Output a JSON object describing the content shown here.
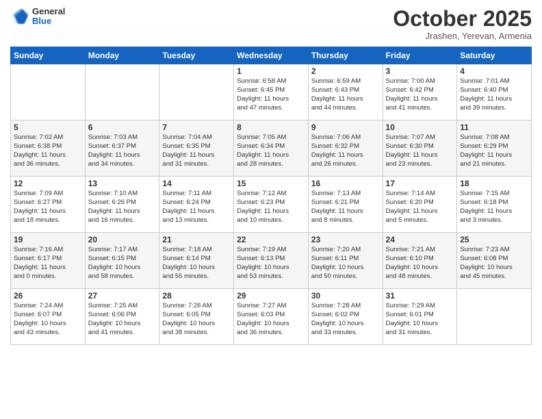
{
  "header": {
    "logo_general": "General",
    "logo_blue": "Blue",
    "month_title": "October 2025",
    "subtitle": "Jrashen, Yerevan, Armenia"
  },
  "days_of_week": [
    "Sunday",
    "Monday",
    "Tuesday",
    "Wednesday",
    "Thursday",
    "Friday",
    "Saturday"
  ],
  "weeks": [
    [
      {
        "day": "",
        "info": ""
      },
      {
        "day": "",
        "info": ""
      },
      {
        "day": "",
        "info": ""
      },
      {
        "day": "1",
        "info": "Sunrise: 6:58 AM\nSunset: 6:45 PM\nDaylight: 11 hours\nand 47 minutes."
      },
      {
        "day": "2",
        "info": "Sunrise: 6:59 AM\nSunset: 6:43 PM\nDaylight: 11 hours\nand 44 minutes."
      },
      {
        "day": "3",
        "info": "Sunrise: 7:00 AM\nSunset: 6:42 PM\nDaylight: 11 hours\nand 41 minutes."
      },
      {
        "day": "4",
        "info": "Sunrise: 7:01 AM\nSunset: 6:40 PM\nDaylight: 11 hours\nand 39 minutes."
      }
    ],
    [
      {
        "day": "5",
        "info": "Sunrise: 7:02 AM\nSunset: 6:38 PM\nDaylight: 11 hours\nand 36 minutes."
      },
      {
        "day": "6",
        "info": "Sunrise: 7:03 AM\nSunset: 6:37 PM\nDaylight: 11 hours\nand 34 minutes."
      },
      {
        "day": "7",
        "info": "Sunrise: 7:04 AM\nSunset: 6:35 PM\nDaylight: 11 hours\nand 31 minutes."
      },
      {
        "day": "8",
        "info": "Sunrise: 7:05 AM\nSunset: 6:34 PM\nDaylight: 11 hours\nand 28 minutes."
      },
      {
        "day": "9",
        "info": "Sunrise: 7:06 AM\nSunset: 6:32 PM\nDaylight: 11 hours\nand 26 minutes."
      },
      {
        "day": "10",
        "info": "Sunrise: 7:07 AM\nSunset: 6:30 PM\nDaylight: 11 hours\nand 23 minutes."
      },
      {
        "day": "11",
        "info": "Sunrise: 7:08 AM\nSunset: 6:29 PM\nDaylight: 11 hours\nand 21 minutes."
      }
    ],
    [
      {
        "day": "12",
        "info": "Sunrise: 7:09 AM\nSunset: 6:27 PM\nDaylight: 11 hours\nand 18 minutes."
      },
      {
        "day": "13",
        "info": "Sunrise: 7:10 AM\nSunset: 6:26 PM\nDaylight: 11 hours\nand 16 minutes."
      },
      {
        "day": "14",
        "info": "Sunrise: 7:11 AM\nSunset: 6:24 PM\nDaylight: 11 hours\nand 13 minutes."
      },
      {
        "day": "15",
        "info": "Sunrise: 7:12 AM\nSunset: 6:23 PM\nDaylight: 11 hours\nand 10 minutes."
      },
      {
        "day": "16",
        "info": "Sunrise: 7:13 AM\nSunset: 6:21 PM\nDaylight: 11 hours\nand 8 minutes."
      },
      {
        "day": "17",
        "info": "Sunrise: 7:14 AM\nSunset: 6:20 PM\nDaylight: 11 hours\nand 5 minutes."
      },
      {
        "day": "18",
        "info": "Sunrise: 7:15 AM\nSunset: 6:18 PM\nDaylight: 11 hours\nand 3 minutes."
      }
    ],
    [
      {
        "day": "19",
        "info": "Sunrise: 7:16 AM\nSunset: 6:17 PM\nDaylight: 11 hours\nand 0 minutes."
      },
      {
        "day": "20",
        "info": "Sunrise: 7:17 AM\nSunset: 6:15 PM\nDaylight: 10 hours\nand 58 minutes."
      },
      {
        "day": "21",
        "info": "Sunrise: 7:18 AM\nSunset: 6:14 PM\nDaylight: 10 hours\nand 55 minutes."
      },
      {
        "day": "22",
        "info": "Sunrise: 7:19 AM\nSunset: 6:13 PM\nDaylight: 10 hours\nand 53 minutes."
      },
      {
        "day": "23",
        "info": "Sunrise: 7:20 AM\nSunset: 6:11 PM\nDaylight: 10 hours\nand 50 minutes."
      },
      {
        "day": "24",
        "info": "Sunrise: 7:21 AM\nSunset: 6:10 PM\nDaylight: 10 hours\nand 48 minutes."
      },
      {
        "day": "25",
        "info": "Sunrise: 7:23 AM\nSunset: 6:08 PM\nDaylight: 10 hours\nand 45 minutes."
      }
    ],
    [
      {
        "day": "26",
        "info": "Sunrise: 7:24 AM\nSunset: 6:07 PM\nDaylight: 10 hours\nand 43 minutes."
      },
      {
        "day": "27",
        "info": "Sunrise: 7:25 AM\nSunset: 6:06 PM\nDaylight: 10 hours\nand 41 minutes."
      },
      {
        "day": "28",
        "info": "Sunrise: 7:26 AM\nSunset: 6:05 PM\nDaylight: 10 hours\nand 38 minutes."
      },
      {
        "day": "29",
        "info": "Sunrise: 7:27 AM\nSunset: 6:03 PM\nDaylight: 10 hours\nand 36 minutes."
      },
      {
        "day": "30",
        "info": "Sunrise: 7:28 AM\nSunset: 6:02 PM\nDaylight: 10 hours\nand 33 minutes."
      },
      {
        "day": "31",
        "info": "Sunrise: 7:29 AM\nSunset: 6:01 PM\nDaylight: 10 hours\nand 31 minutes."
      },
      {
        "day": "",
        "info": ""
      }
    ]
  ]
}
